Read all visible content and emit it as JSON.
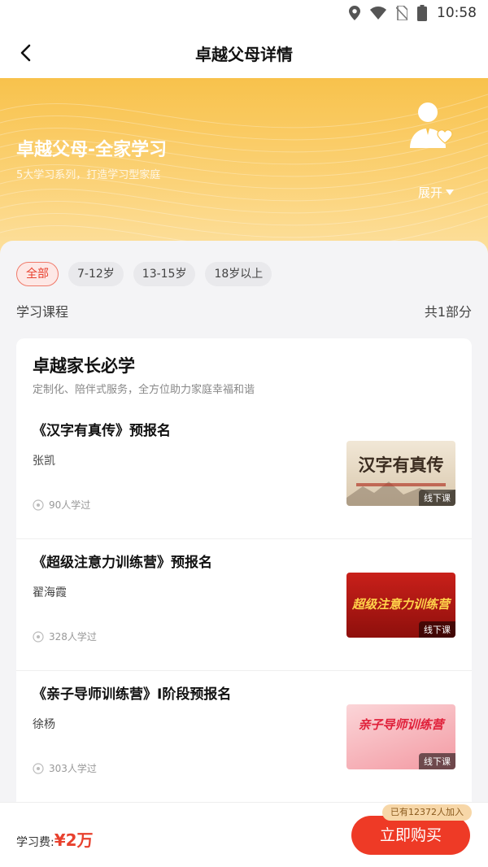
{
  "status_bar": {
    "time": "10:58"
  },
  "nav": {
    "title": "卓越父母详情"
  },
  "hero": {
    "title": "卓越父母-全家学习",
    "subtitle": "5大学习系列，打造学习型家庭",
    "expand_label": "展开"
  },
  "filters": [
    "全部",
    "7-12岁",
    "13-15岁",
    "18岁以上"
  ],
  "section": {
    "label": "学习课程",
    "count": "共1部分"
  },
  "card": {
    "title": "卓越家长必学",
    "subtitle": "定制化、陪伴式服务，全方位助力家庭幸福和谐",
    "courses": [
      {
        "name": "《汉字有真传》预报名",
        "teacher": "张凯",
        "learned": "90人学过",
        "thumb_text": "汉字有真传",
        "badge": "线下课"
      },
      {
        "name": "《超级注意力训练营》预报名",
        "teacher": "翟海霞",
        "learned": "328人学过",
        "thumb_text": "超级注意力训练营",
        "badge": "线下课"
      },
      {
        "name": "《亲子导师训练营》I阶段预报名",
        "teacher": "徐杨",
        "learned": "303人学过",
        "thumb_text": "亲子导师训练营",
        "badge": "线下课"
      }
    ]
  },
  "bottom": {
    "fee_label": "学习费:",
    "price": "¥2万",
    "joined": "已有12372人加入",
    "buy_label": "立即购买"
  },
  "colors": {
    "accent": "#ee3a26",
    "hero": "#f8c24c"
  }
}
